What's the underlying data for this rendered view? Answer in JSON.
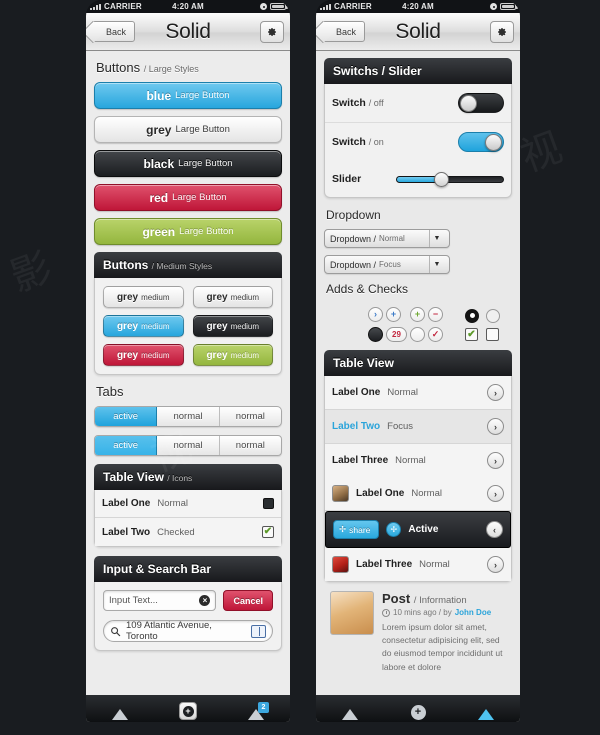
{
  "status_bar": {
    "carrier": "CARRIER",
    "time": "4:20 AM"
  },
  "nav": {
    "back": "Back",
    "title": "Solid",
    "gear_icon": "gear-icon"
  },
  "left": {
    "buttons_large": {
      "title": "Buttons",
      "subtitle": "/ Large Styles",
      "items": [
        {
          "strong": "blue",
          "lite": "Large Button",
          "style": "bg-blue"
        },
        {
          "strong": "grey",
          "lite": "Large Button",
          "style": "bg-grey"
        },
        {
          "strong": "black",
          "lite": "Large Button",
          "style": "bg-black"
        },
        {
          "strong": "red",
          "lite": "Large Button",
          "style": "bg-red"
        },
        {
          "strong": "green",
          "lite": "Large Button",
          "style": "bg-green"
        }
      ]
    },
    "buttons_medium": {
      "title": "Buttons",
      "subtitle": "/ Medium Styles",
      "items": [
        {
          "strong": "grey",
          "lite": "medium",
          "style": "bg-grey"
        },
        {
          "strong": "grey",
          "lite": "medium",
          "style": "bg-grey"
        },
        {
          "strong": "grey",
          "lite": "medium",
          "style": "bg-blue"
        },
        {
          "strong": "grey",
          "lite": "medium",
          "style": "bg-black"
        },
        {
          "strong": "grey",
          "lite": "medium",
          "style": "bg-red"
        },
        {
          "strong": "grey",
          "lite": "medium",
          "style": "bg-green"
        }
      ]
    },
    "tabs": {
      "title": "Tabs",
      "row1": [
        "active",
        "normal",
        "normal"
      ],
      "row2": [
        "active",
        "normal",
        "normal"
      ],
      "active_index": 0
    },
    "table_view": {
      "title": "Table View",
      "subtitle": "/ Icons",
      "rows": [
        {
          "label": "Label One",
          "state": "Normal",
          "icon": "square-filled-icon"
        },
        {
          "label": "Label Two",
          "state": "Checked",
          "icon": "checkbox-checked-icon"
        }
      ]
    },
    "input_search": {
      "title": "Input & Search Bar",
      "input_placeholder": "Input Text...",
      "input_value": "",
      "clear_icon": "clear-circle-icon",
      "cancel_label": "Cancel",
      "search_value": "109 Atlantic Avenue, Toronto",
      "search_icon": "search-icon",
      "book_icon": "bookmark-icon"
    }
  },
  "right": {
    "switches": {
      "title": "Switchs / Slider",
      "rows": [
        {
          "label": "Switch",
          "sub": "/ off",
          "state": "off"
        },
        {
          "label": "Switch",
          "sub": "/ on",
          "state": "on"
        }
      ],
      "slider": {
        "label": "Slider",
        "value": 42
      }
    },
    "dropdown": {
      "title": "Dropdown",
      "items": [
        {
          "label": "Dropdown /",
          "sub": "Normal"
        },
        {
          "label": "Dropdown /",
          "sub": "Focus"
        }
      ],
      "arrow_icon": "chevron-down-icon"
    },
    "adds_checks": {
      "title": "Adds & Checks",
      "row1": [
        {
          "glyph": "›",
          "cls": "blue",
          "name": "chevron-right-icon"
        },
        {
          "glyph": "+",
          "cls": "blue",
          "name": "plus-icon"
        },
        {
          "glyph": "+",
          "cls": "green",
          "name": "plus-green-icon"
        },
        {
          "glyph": "−",
          "cls": "red",
          "name": "minus-icon"
        }
      ],
      "row2": [
        {
          "glyph": "",
          "cls": "dark",
          "name": "circle-filled-icon"
        },
        {
          "glyph": "29",
          "cls": "badge",
          "name": "count-badge"
        },
        {
          "glyph": "",
          "cls": "blank",
          "name": "circle-empty-icon"
        },
        {
          "glyph": "✓",
          "cls": "red",
          "name": "check-icon"
        }
      ],
      "radio_selected": "radio-selected-icon",
      "radio_empty": "radio-empty-icon",
      "check_checked": "checkbox-checked-icon",
      "check_empty": "checkbox-empty-icon",
      "check_glyph": "✔"
    },
    "table_view": {
      "title": "Table View",
      "rows": [
        {
          "label": "Label One",
          "state": "Normal",
          "kind": "plain",
          "chev": "›"
        },
        {
          "label": "Label Two",
          "state": "Focus",
          "kind": "focus",
          "chev": "›"
        },
        {
          "label": "Label Three",
          "state": "Normal",
          "kind": "plain",
          "chev": "›"
        }
      ],
      "avatar_rows": [
        {
          "label": "Label One",
          "state": "Normal",
          "kind": "avatar",
          "avatar": "av1",
          "chev": "›"
        },
        {
          "label": "Active",
          "state": "",
          "kind": "active",
          "share_label": "share",
          "share_icon": "share-icon",
          "chev": "‹"
        },
        {
          "label": "Label Three",
          "state": "Normal",
          "kind": "avatar",
          "avatar": "av3",
          "chev": "›"
        }
      ]
    },
    "post": {
      "title": "Post",
      "subtitle": "/ Information",
      "time": "10 mins ago / by",
      "author": "John Doe",
      "clock_icon": "clock-icon",
      "body": "Lorem ipsum dolor sit amet, consectetur adipisicing elit, sed do eiusmod tempor incididunt ut labore et dolore"
    }
  },
  "tabbar": {
    "badge": "2",
    "plus": "+",
    "dot": "+"
  }
}
